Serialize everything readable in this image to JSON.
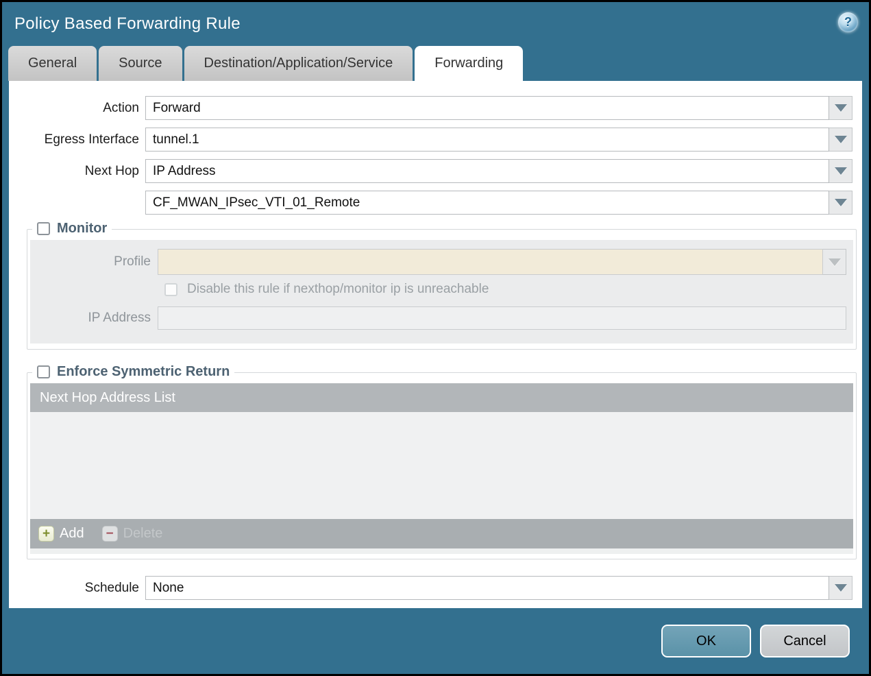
{
  "dialog": {
    "title": "Policy Based Forwarding Rule"
  },
  "icons": {
    "help": "?",
    "dropdown": "triangle-down",
    "add_plus": "+",
    "delete_minus": "−"
  },
  "tabs": [
    {
      "label": "General",
      "active": false
    },
    {
      "label": "Source",
      "active": false
    },
    {
      "label": "Destination/Application/Service",
      "active": false
    },
    {
      "label": "Forwarding",
      "active": true
    }
  ],
  "form": {
    "action": {
      "label": "Action",
      "value": "Forward"
    },
    "egress_interface": {
      "label": "Egress Interface",
      "value": "tunnel.1"
    },
    "next_hop": {
      "label": "Next Hop",
      "value": "IP Address"
    },
    "next_hop_address": {
      "value": "CF_MWAN_IPsec_VTI_01_Remote"
    },
    "schedule": {
      "label": "Schedule",
      "value": "None"
    }
  },
  "monitor": {
    "legend": "Monitor",
    "checked": false,
    "profile_label": "Profile",
    "profile_value": "",
    "disable_checkbox_label": "Disable this rule if nexthop/monitor ip is unreachable",
    "disable_checkbox_checked": false,
    "ip_address_label": "IP Address",
    "ip_address_value": ""
  },
  "symmetric_return": {
    "legend": "Enforce Symmetric Return",
    "checked": false,
    "table_header": "Next Hop Address List",
    "rows": [],
    "add_label": "Add",
    "delete_label": "Delete",
    "delete_enabled": false
  },
  "footer": {
    "ok_label": "OK",
    "cancel_label": "Cancel"
  },
  "colors": {
    "frame_teal": "#33708f",
    "active_tab_bg": "#ffffff",
    "inactive_tab_bg": "#cccccc",
    "table_header_bg": "#b2b6b9",
    "table_footer_bg": "#a9aeb1",
    "profile_field_bg": "#f2ebd9",
    "ok_button_bg": "#5a92a8",
    "cancel_button_bg": "#c5c8cb",
    "legend_text": "#4d6272"
  }
}
